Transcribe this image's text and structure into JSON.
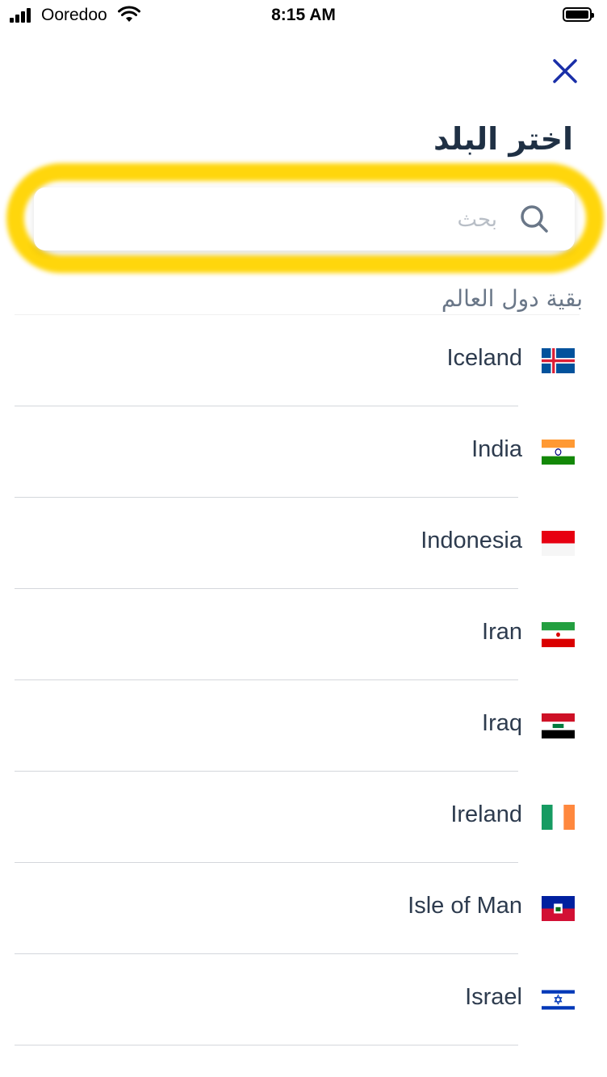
{
  "status_bar": {
    "carrier": "Ooredoo",
    "time": "8:15 AM"
  },
  "header": {
    "title": "اختر البلد",
    "close_icon": "close-icon"
  },
  "search": {
    "placeholder": "بحث",
    "value": "",
    "icon": "search-icon",
    "highlight_color": "#ffd400"
  },
  "section": {
    "label": "بقية دول العالم"
  },
  "countries": [
    {
      "name": "Iceland",
      "flag": "iceland"
    },
    {
      "name": "India",
      "flag": "india"
    },
    {
      "name": "Indonesia",
      "flag": "indonesia"
    },
    {
      "name": "Iran",
      "flag": "iran"
    },
    {
      "name": "Iraq",
      "flag": "iraq"
    },
    {
      "name": "Ireland",
      "flag": "ireland"
    },
    {
      "name": "Isle of Man",
      "flag": "isle-of-man"
    },
    {
      "name": "Israel",
      "flag": "israel"
    }
  ],
  "colors": {
    "accent": "#1a2fa8",
    "text": "#2d3b4e",
    "muted": "#6a7788"
  }
}
